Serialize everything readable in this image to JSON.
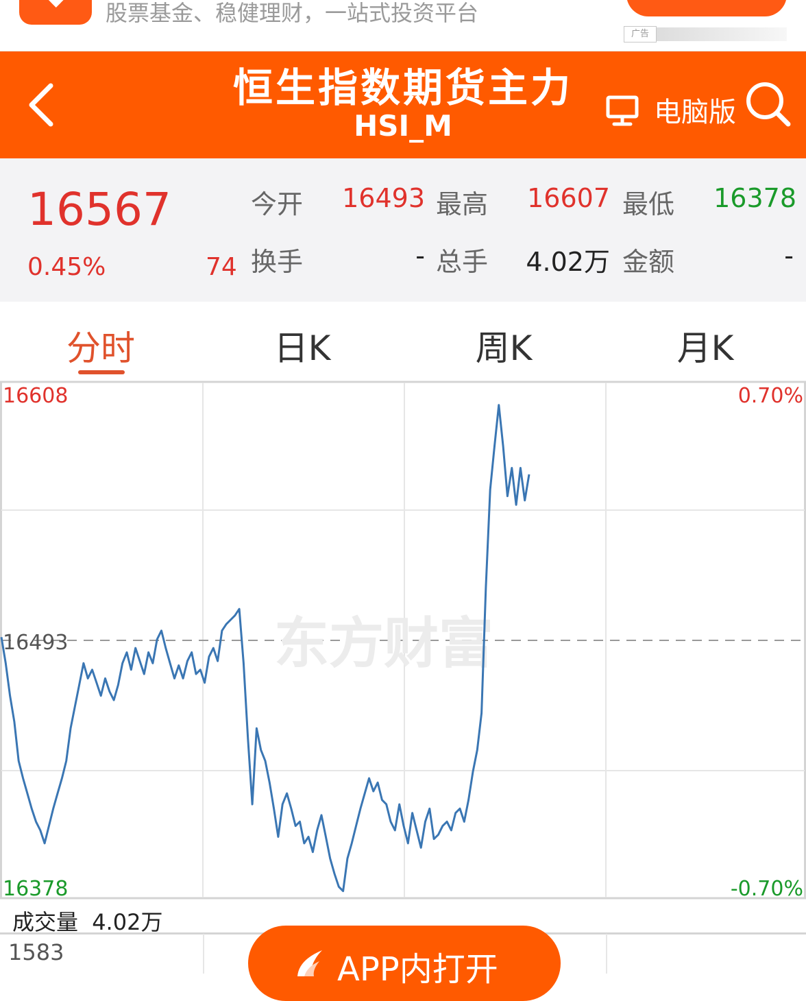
{
  "ad": {
    "tagline": "股票基金、稳健理财，一站式投资平台",
    "tag": "广告"
  },
  "header": {
    "title": "恒生指数期货主力",
    "code": "HSI_M",
    "pc_label": "电脑版"
  },
  "quote": {
    "price": "16567",
    "change_pct": "0.45%",
    "change": "74",
    "open_label": "今开",
    "open": "16493",
    "high_label": "最高",
    "high": "16607",
    "low_label": "最低",
    "low": "16378",
    "turnover_label": "换手",
    "turnover": "-",
    "volume_label": "总手",
    "volume": "4.02万",
    "amount_label": "金额",
    "amount": "-"
  },
  "tabs": [
    "分时",
    "日K",
    "周K",
    "月K"
  ],
  "chart_data": {
    "type": "line",
    "title": "",
    "y_max_label": "16608",
    "y_mid_label": "16493",
    "y_min_label": "16378",
    "pct_max_label": "0.70%",
    "pct_min_label": "-0.70%",
    "ylim": [
      16378,
      16608
    ],
    "reference": 16493,
    "watermark": "东方财富",
    "series": [
      {
        "color": "#3a76b3",
        "values": [
          16497,
          16485,
          16470,
          16458,
          16440,
          16432,
          16425,
          16418,
          16412,
          16408,
          16402,
          16410,
          16418,
          16425,
          16432,
          16440,
          16455,
          16465,
          16475,
          16485,
          16478,
          16482,
          16476,
          16470,
          16478,
          16472,
          16468,
          16475,
          16485,
          16490,
          16482,
          16492,
          16486,
          16480,
          16490,
          16485,
          16496,
          16500,
          16492,
          16485,
          16478,
          16484,
          16478,
          16486,
          16490,
          16480,
          16482,
          16476,
          16488,
          16492,
          16486,
          16500,
          16503,
          16505,
          16507,
          16510,
          16485,
          16450,
          16420,
          16455,
          16445,
          16440,
          16430,
          16418,
          16405,
          16420,
          16425,
          16418,
          16410,
          16412,
          16402,
          16405,
          16398,
          16408,
          16415,
          16405,
          16395,
          16388,
          16382,
          16380,
          16395,
          16402,
          16410,
          16418,
          16425,
          16432,
          16426,
          16430,
          16422,
          16420,
          16412,
          16408,
          16420,
          16410,
          16402,
          16416,
          16408,
          16400,
          16412,
          16418,
          16404,
          16406,
          16410,
          16412,
          16408,
          16416,
          16418,
          16412,
          16422,
          16435,
          16445,
          16462,
          16520,
          16565,
          16585,
          16604,
          16585,
          16562,
          16575,
          16558,
          16575,
          16560,
          16572
        ]
      }
    ]
  },
  "volume": {
    "label": "成交量",
    "value": "4.02万",
    "max": "1583"
  },
  "app_button": {
    "label": "APP内打开"
  },
  "colors": {
    "brand": "#ff5a00",
    "up": "#e0322c",
    "down": "#1a9a2a",
    "line": "#3a76b3"
  }
}
